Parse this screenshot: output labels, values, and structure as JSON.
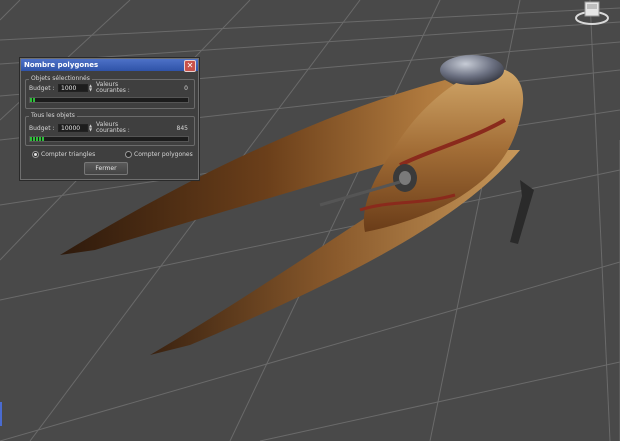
{
  "dialog": {
    "title": "Nombre polygones",
    "close_glyph": "✕",
    "selected_group": {
      "label": "Objets sélectionnés",
      "budget_label": "Budget :",
      "budget_value": "1000",
      "current_label_line1": "Valeurs",
      "current_label_line2": "courantes :",
      "current_value": "0",
      "progress_fraction": 0.03
    },
    "all_group": {
      "label": "Tous les objets",
      "budget_label": "Budget :",
      "budget_value": "10000",
      "current_label_line1": "Valeurs",
      "current_label_line2": "courantes :",
      "current_value": "845",
      "progress_fraction": 0.09
    },
    "count_triangles_label": "Compter triangles",
    "count_polygons_label": "Compter polygones",
    "count_mode": "triangles",
    "close_button_label": "Fermer"
  },
  "colors": {
    "viewport_bg": "#494949",
    "grid_line": "#6a6a6a",
    "titlebar": "#3a5fb8",
    "progress_fill": "#2fbf3a",
    "model_tan": "#b07a3e",
    "model_dark": "#5a3416"
  },
  "icons": {
    "viewcube": "viewcube-icon",
    "close": "close-icon",
    "spinner": "spinner-arrows-icon"
  }
}
